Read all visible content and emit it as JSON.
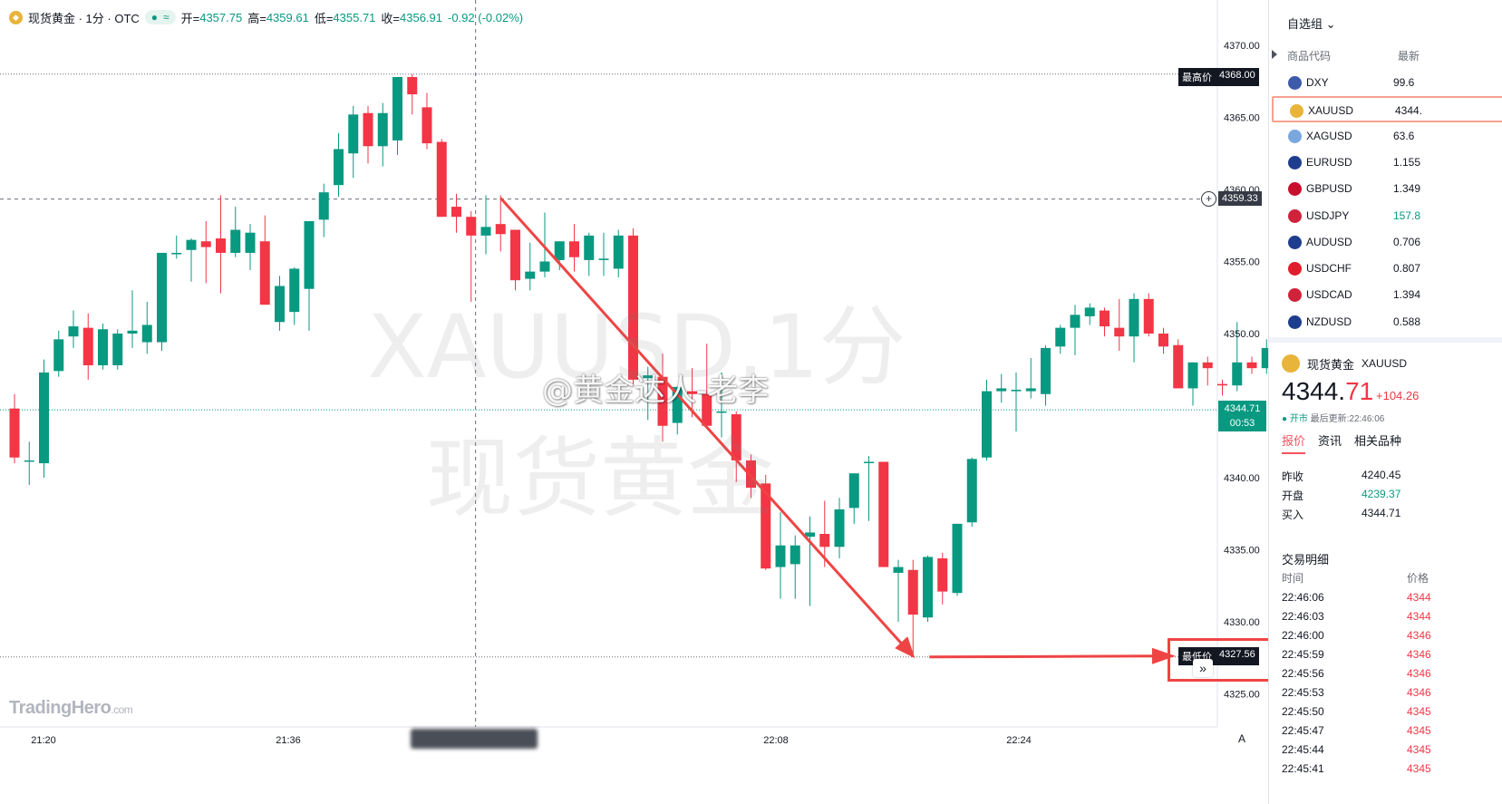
{
  "chart": {
    "legend": {
      "title": "现货黄金 · 1分 · OTC",
      "open_label": "开=",
      "open": "4357.75",
      "high_label": "高=",
      "high": "4359.61",
      "low_label": "低=",
      "low": "4355.71",
      "close_label": "收=",
      "close": "4356.91",
      "change": "-0.92 (-0.02%)"
    },
    "watermark_symbol": "XAUUSD,1分",
    "watermark_name": "现货黄金",
    "weibo_watermark": "@黄金达人-老李",
    "brand": "TradingHero",
    "brand_suffix": ".com",
    "price_ticks": [
      "4370.00",
      "4365.00",
      "4360.00",
      "4355.00",
      "4350.00",
      "4340.00",
      "4335.00",
      "4330.00",
      "4325.00"
    ],
    "time_ticks": [
      "21:20",
      "21:36",
      "22:08",
      "22:24"
    ],
    "high_label": "最高价",
    "high_value": "4368.00",
    "crosshair_price": "4359.33",
    "last_price": "4344.71",
    "countdown": "00:53",
    "low_label": "最低价",
    "low_value": "4327.56",
    "auto_scale_label": "A",
    "scroll_button": "»",
    "colors": {
      "up": "#089981",
      "down": "#f23645",
      "arrow": "#ef4444"
    }
  },
  "chart_data": {
    "type": "candlestick",
    "title": "现货黄金 · 1分 · OTC",
    "ylim": [
      4323.5,
      4371.5
    ],
    "yticks": [
      4325,
      4330,
      4335,
      4340,
      4345,
      4350,
      4355,
      4360,
      4365,
      4370
    ],
    "xticks": [
      "21:20",
      "21:36",
      "22:08",
      "22:24"
    ],
    "high": 4368.0,
    "low": 4327.56,
    "last": 4344.71,
    "candles": [
      {
        "o": 4344.8,
        "h": 4345.8,
        "l": 4341.0,
        "c": 4341.4
      },
      {
        "o": 4341.2,
        "h": 4342.5,
        "l": 4339.5,
        "c": 4341.2
      },
      {
        "o": 4341.0,
        "h": 4348.2,
        "l": 4340.0,
        "c": 4347.3
      },
      {
        "o": 4347.4,
        "h": 4350.2,
        "l": 4347.0,
        "c": 4349.6
      },
      {
        "o": 4349.8,
        "h": 4351.6,
        "l": 4349.0,
        "c": 4350.5
      },
      {
        "o": 4350.4,
        "h": 4351.4,
        "l": 4346.8,
        "c": 4347.8
      },
      {
        "o": 4347.8,
        "h": 4350.7,
        "l": 4347.5,
        "c": 4350.3
      },
      {
        "o": 4347.8,
        "h": 4350.3,
        "l": 4347.5,
        "c": 4350.0
      },
      {
        "o": 4350.0,
        "h": 4353.0,
        "l": 4349.0,
        "c": 4350.2
      },
      {
        "o": 4349.4,
        "h": 4352.2,
        "l": 4348.6,
        "c": 4350.6
      },
      {
        "o": 4349.4,
        "h": 4355.6,
        "l": 4348.8,
        "c": 4355.6
      },
      {
        "o": 4355.5,
        "h": 4356.8,
        "l": 4355.2,
        "c": 4355.6
      },
      {
        "o": 4355.8,
        "h": 4356.6,
        "l": 4353.6,
        "c": 4356.5
      },
      {
        "o": 4356.4,
        "h": 4357.8,
        "l": 4353.5,
        "c": 4356.0
      },
      {
        "o": 4356.6,
        "h": 4359.6,
        "l": 4352.8,
        "c": 4355.6
      },
      {
        "o": 4355.6,
        "h": 4358.8,
        "l": 4355.3,
        "c": 4357.2
      },
      {
        "o": 4355.6,
        "h": 4357.6,
        "l": 4354.4,
        "c": 4357.0
      },
      {
        "o": 4356.4,
        "h": 4358.2,
        "l": 4352.2,
        "c": 4352.0
      },
      {
        "o": 4350.8,
        "h": 4354.0,
        "l": 4350.2,
        "c": 4353.3
      },
      {
        "o": 4351.5,
        "h": 4354.6,
        "l": 4350.6,
        "c": 4354.5
      },
      {
        "o": 4353.1,
        "h": 4357.7,
        "l": 4350.2,
        "c": 4357.8
      },
      {
        "o": 4357.9,
        "h": 4360.4,
        "l": 4356.7,
        "c": 4359.8
      },
      {
        "o": 4360.3,
        "h": 4363.9,
        "l": 4359.5,
        "c": 4362.8
      },
      {
        "o": 4362.5,
        "h": 4365.8,
        "l": 4360.8,
        "c": 4365.2
      },
      {
        "o": 4365.3,
        "h": 4365.8,
        "l": 4361.8,
        "c": 4363.0
      },
      {
        "o": 4363.0,
        "h": 4366.0,
        "l": 4361.6,
        "c": 4365.3
      },
      {
        "o": 4363.4,
        "h": 4367.8,
        "l": 4362.4,
        "c": 4367.8
      },
      {
        "o": 4367.8,
        "h": 4368.0,
        "l": 4365.2,
        "c": 4366.6
      },
      {
        "o": 4365.7,
        "h": 4366.7,
        "l": 4362.8,
        "c": 4363.2
      },
      {
        "o": 4363.3,
        "h": 4363.5,
        "l": 4358.8,
        "c": 4358.1
      },
      {
        "o": 4358.8,
        "h": 4359.7,
        "l": 4357.0,
        "c": 4358.1
      },
      {
        "o": 4358.1,
        "h": 4358.5,
        "l": 4352.2,
        "c": 4356.8
      },
      {
        "o": 4356.8,
        "h": 4359.6,
        "l": 4355.5,
        "c": 4357.4
      },
      {
        "o": 4357.6,
        "h": 4359.6,
        "l": 4355.7,
        "c": 4356.9
      },
      {
        "o": 4357.2,
        "h": 4356.9,
        "l": 4353.0,
        "c": 4353.7
      },
      {
        "o": 4353.8,
        "h": 4356.3,
        "l": 4353.0,
        "c": 4354.3
      },
      {
        "o": 4354.3,
        "h": 4358.4,
        "l": 4353.9,
        "c": 4355.0
      },
      {
        "o": 4355.1,
        "h": 4356.2,
        "l": 4354.4,
        "c": 4356.4
      },
      {
        "o": 4356.4,
        "h": 4357.6,
        "l": 4354.3,
        "c": 4355.3
      },
      {
        "o": 4355.1,
        "h": 4357.0,
        "l": 4354.0,
        "c": 4356.8
      },
      {
        "o": 4355.1,
        "h": 4357.0,
        "l": 4354.0,
        "c": 4355.2
      },
      {
        "o": 4354.5,
        "h": 4357.2,
        "l": 4353.9,
        "c": 4356.8
      },
      {
        "o": 4356.8,
        "h": 4357.3,
        "l": 4346.4,
        "c": 4346.8
      },
      {
        "o": 4346.9,
        "h": 4347.7,
        "l": 4344.0,
        "c": 4347.1
      },
      {
        "o": 4347.0,
        "h": 4348.6,
        "l": 4342.5,
        "c": 4343.6
      },
      {
        "o": 4343.8,
        "h": 4346.3,
        "l": 4343.0,
        "c": 4346.3
      },
      {
        "o": 4346.0,
        "h": 4347.6,
        "l": 4344.2,
        "c": 4345.8
      },
      {
        "o": 4345.8,
        "h": 4349.3,
        "l": 4345.5,
        "c": 4343.6
      },
      {
        "o": 4344.5,
        "h": 4347.3,
        "l": 4342.8,
        "c": 4344.6
      },
      {
        "o": 4344.4,
        "h": 4344.6,
        "l": 4339.7,
        "c": 4341.2
      },
      {
        "o": 4341.2,
        "h": 4341.6,
        "l": 4338.6,
        "c": 4339.3
      },
      {
        "o": 4339.6,
        "h": 4340.2,
        "l": 4333.6,
        "c": 4333.7
      },
      {
        "o": 4333.8,
        "h": 4337.6,
        "l": 4331.6,
        "c": 4335.3
      },
      {
        "o": 4334.0,
        "h": 4336.0,
        "l": 4331.6,
        "c": 4335.3
      },
      {
        "o": 4335.9,
        "h": 4337.3,
        "l": 4331.1,
        "c": 4336.2
      },
      {
        "o": 4336.1,
        "h": 4338.4,
        "l": 4333.8,
        "c": 4335.2
      },
      {
        "o": 4335.2,
        "h": 4338.6,
        "l": 4334.4,
        "c": 4337.8
      },
      {
        "o": 4337.9,
        "h": 4339.5,
        "l": 4336.8,
        "c": 4340.3
      },
      {
        "o": 4341.1,
        "h": 4341.5,
        "l": 4337.0,
        "c": 4341.1
      },
      {
        "o": 4341.1,
        "h": 4341.1,
        "l": 4333.8,
        "c": 4333.8
      },
      {
        "o": 4333.4,
        "h": 4334.3,
        "l": 4330.0,
        "c": 4333.8
      },
      {
        "o": 4333.6,
        "h": 4334.3,
        "l": 4327.6,
        "c": 4330.5
      },
      {
        "o": 4330.3,
        "h": 4334.6,
        "l": 4330.0,
        "c": 4334.5
      },
      {
        "o": 4334.4,
        "h": 4334.8,
        "l": 4331.2,
        "c": 4332.1
      },
      {
        "o": 4332.0,
        "h": 4336.1,
        "l": 4331.8,
        "c": 4336.8
      },
      {
        "o": 4336.9,
        "h": 4341.4,
        "l": 4336.6,
        "c": 4341.3
      },
      {
        "o": 4341.4,
        "h": 4346.8,
        "l": 4341.2,
        "c": 4346.0
      },
      {
        "o": 4346.0,
        "h": 4347.2,
        "l": 4345.2,
        "c": 4346.2
      },
      {
        "o": 4346.0,
        "h": 4347.3,
        "l": 4343.2,
        "c": 4346.1
      },
      {
        "o": 4346.0,
        "h": 4348.3,
        "l": 4345.5,
        "c": 4346.2
      },
      {
        "o": 4345.8,
        "h": 4349.2,
        "l": 4345.0,
        "c": 4349.0
      },
      {
        "o": 4349.1,
        "h": 4350.6,
        "l": 4348.6,
        "c": 4350.4
      },
      {
        "o": 4350.4,
        "h": 4352.0,
        "l": 4348.5,
        "c": 4351.3
      },
      {
        "o": 4351.2,
        "h": 4352.1,
        "l": 4350.6,
        "c": 4351.8
      },
      {
        "o": 4351.6,
        "h": 4351.8,
        "l": 4349.8,
        "c": 4350.5
      },
      {
        "o": 4350.4,
        "h": 4352.4,
        "l": 4348.8,
        "c": 4349.8
      },
      {
        "o": 4349.8,
        "h": 4352.8,
        "l": 4348.0,
        "c": 4352.4
      },
      {
        "o": 4352.4,
        "h": 4352.8,
        "l": 4349.8,
        "c": 4350.0
      },
      {
        "o": 4350.0,
        "h": 4350.4,
        "l": 4348.6,
        "c": 4349.1
      },
      {
        "o": 4349.2,
        "h": 4349.6,
        "l": 4346.2,
        "c": 4346.2
      },
      {
        "o": 4346.2,
        "h": 4347.6,
        "l": 4345.0,
        "c": 4348.0
      },
      {
        "o": 4348.0,
        "h": 4348.4,
        "l": 4346.4,
        "c": 4347.6
      },
      {
        "o": 4346.5,
        "h": 4346.8,
        "l": 4345.7,
        "c": 4346.4
      },
      {
        "o": 4346.4,
        "h": 4350.8,
        "l": 4346.0,
        "c": 4348.0
      },
      {
        "o": 4348.0,
        "h": 4348.4,
        "l": 4347.2,
        "c": 4347.6
      },
      {
        "o": 4347.6,
        "h": 4349.6,
        "l": 4347.2,
        "c": 4349.0
      },
      {
        "o": 4347.2,
        "h": 4349.4,
        "l": 4346.8,
        "c": 4349.0
      }
    ],
    "arrow_annotation": {
      "from": {
        "candle": 33,
        "price": 4359.4
      },
      "to": {
        "candle": 61,
        "price": 4327.6
      },
      "horizontal_to_price": 4327.56
    }
  },
  "watchlist": {
    "header": "自选组",
    "col_symbol": "商品代码",
    "col_last": "最新",
    "items": [
      {
        "symbol": "DXY",
        "last": "99.6",
        "icon": "us-flag-icon",
        "color": "#3c5ba9",
        "selected": false,
        "last_color": "#131722"
      },
      {
        "symbol": "XAUUSD",
        "last": "4344.",
        "icon": "gold-icon",
        "color": "#e8b43a",
        "selected": true,
        "last_color": "#131722"
      },
      {
        "symbol": "XAGUSD",
        "last": "63.6",
        "icon": "silver-icon",
        "color": "#7aa7e0",
        "selected": false,
        "last_color": "#131722"
      },
      {
        "symbol": "EURUSD",
        "last": "1.155",
        "icon": "eu-flag-icon",
        "color": "#1f3d8f",
        "selected": false,
        "last_color": "#131722"
      },
      {
        "symbol": "GBPUSD",
        "last": "1.349",
        "icon": "gb-flag-icon",
        "color": "#c8102e",
        "selected": false,
        "last_color": "#131722"
      },
      {
        "symbol": "USDJPY",
        "last": "157.8",
        "icon": "jp-flag-icon",
        "color": "#d0223a",
        "selected": false,
        "last_color": "#089981"
      },
      {
        "symbol": "AUDUSD",
        "last": "0.706",
        "icon": "au-flag-icon",
        "color": "#1f3d8f",
        "selected": false,
        "last_color": "#131722"
      },
      {
        "symbol": "USDCHF",
        "last": "0.807",
        "icon": "ch-flag-icon",
        "color": "#e11d2e",
        "selected": false,
        "last_color": "#131722"
      },
      {
        "symbol": "USDCAD",
        "last": "1.394",
        "icon": "ca-flag-icon",
        "color": "#d0223a",
        "selected": false,
        "last_color": "#131722"
      },
      {
        "symbol": "NZDUSD",
        "last": "0.588",
        "icon": "nz-flag-icon",
        "color": "#1f3d8f",
        "selected": false,
        "last_color": "#131722"
      }
    ]
  },
  "details": {
    "name": "现货黄金",
    "symbol": "XAUUSD",
    "price_main": "4344.",
    "price_dec": "71",
    "change": "+104.26",
    "market_status": "● 开市",
    "last_update": "最后更新:22:46:06",
    "tabs": [
      "报价",
      "资讯",
      "相关品种"
    ],
    "quotes": [
      {
        "label": "昨收",
        "value": "4240.45",
        "green": false
      },
      {
        "label": "开盘",
        "value": "4239.37",
        "green": true
      },
      {
        "label": "买入",
        "value": "4344.71",
        "green": false
      }
    ],
    "ticks_title": "交易明细",
    "ticks_col_time": "时间",
    "ticks_col_price": "价格",
    "ticks": [
      {
        "time": "22:46:06",
        "price": "4344"
      },
      {
        "time": "22:46:03",
        "price": "4344"
      },
      {
        "time": "22:46:00",
        "price": "4346"
      },
      {
        "time": "22:45:59",
        "price": "4346"
      },
      {
        "time": "22:45:56",
        "price": "4346"
      },
      {
        "time": "22:45:53",
        "price": "4346"
      },
      {
        "time": "22:45:50",
        "price": "4345"
      },
      {
        "time": "22:45:47",
        "price": "4345"
      },
      {
        "time": "22:45:44",
        "price": "4345"
      },
      {
        "time": "22:45:41",
        "price": "4345"
      }
    ]
  }
}
